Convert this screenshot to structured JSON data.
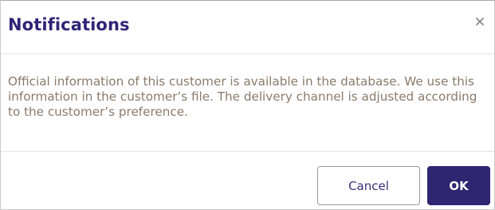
{
  "dialog": {
    "title": "Notifications",
    "close_icon": "close-icon",
    "message": "Official information of this customer is available in the database. We use this information in the customer’s file. The delivery channel is adjusted according to the customer’s preference.",
    "buttons": {
      "cancel_label": "Cancel",
      "ok_label": "OK"
    }
  },
  "colors": {
    "title": "#2f2476",
    "message": "#8a7a6a",
    "primary": "#2e2671",
    "close_icon": "#8a8a8a"
  }
}
